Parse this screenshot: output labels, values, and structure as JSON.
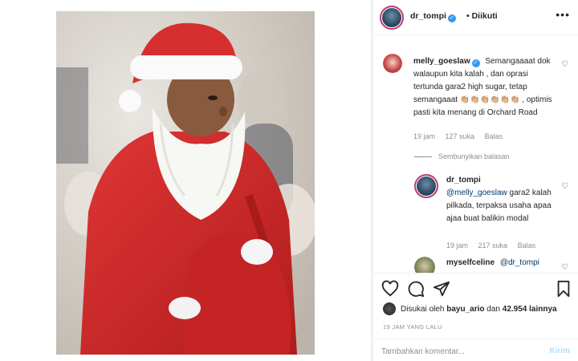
{
  "post": {
    "author": "dr_tompi",
    "follow_state": "Diikuti",
    "more_icon": "more-horizontal-icon"
  },
  "comments": {
    "main": {
      "user": "melly_goeslaw",
      "text": "Semangaaaat dok walaupun kita kalah , dan oprasi tertunda gara2 high sugar, tetap semangaaat 👏🏼👏🏼👏🏼👏🏼👏🏼👏🏼 , optimis pasti kita menang di Orchard Road",
      "time": "19 jam",
      "likes": "127 suka",
      "reply": "Balas"
    },
    "hide_replies": "Sembunyikan balasan",
    "reply1": {
      "user": "dr_tompi",
      "mention": "@melly_goeslaw",
      "text": "gara2 kalah pilkada, terpaksa usaha apaa ajaa buat balikin modal",
      "time": "19 jam",
      "likes": "217 suka",
      "reply": "Balas"
    },
    "reply2": {
      "user": "myselfceline",
      "mention": "@dr_tompi"
    }
  },
  "actions": {
    "liked_by_prefix": "Disukai oleh",
    "liked_by_user": "bayu_ario",
    "liked_by_and": "dan",
    "liked_by_count": "42.954 lainnya",
    "timestamp": "19 JAM YANG LALU"
  },
  "composer": {
    "placeholder": "Tambahkan komentar...",
    "post_label": "Kirim"
  },
  "colors": {
    "verified": "#3897f0",
    "story_ring": "#c0377a",
    "post_button_disabled": "#b2dffc",
    "santa_red": "#d42a2a"
  }
}
